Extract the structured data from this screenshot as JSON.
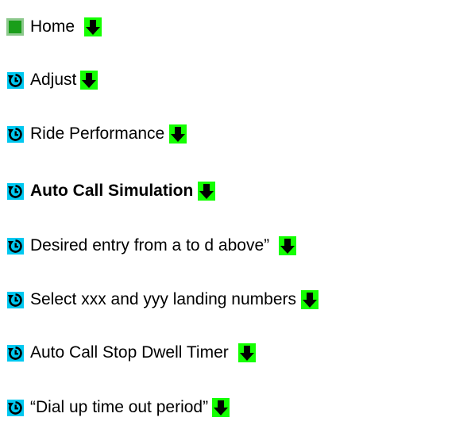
{
  "icons": {
    "first": "square-icon",
    "step": "refresh-icon",
    "action": "down-arrow-icon"
  },
  "colors": {
    "square_fill": "#1a9e1a",
    "square_border": "#8dc88d",
    "icon_bg": "#14ff00",
    "icon_fg": "#000000",
    "rotate_bg": "#00c8f0"
  },
  "items": [
    {
      "label": "Home",
      "bold": false
    },
    {
      "label": "Adjust",
      "bold": false
    },
    {
      "label": "Ride Performance",
      "bold": false
    },
    {
      "label": "Auto Call Simulation",
      "bold": true
    },
    {
      "label": "Desired entry from a to d above”",
      "bold": false
    },
    {
      "label": "Select xxx and yyy landing numbers",
      "bold": false
    },
    {
      "label": "Auto Call Stop Dwell Timer",
      "bold": false
    },
    {
      "label": "“Dial up time out period”",
      "bold": false
    }
  ]
}
